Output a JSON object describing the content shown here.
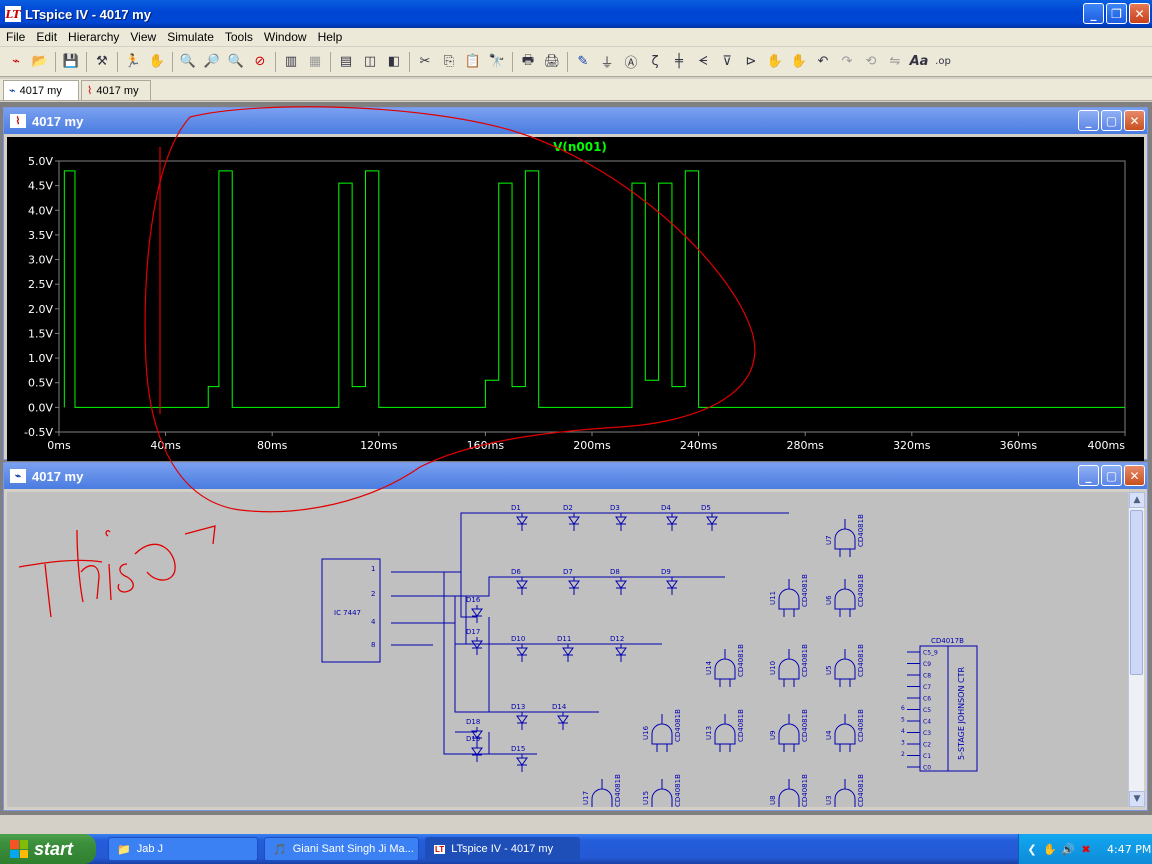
{
  "window": {
    "title": "LTspice IV - 4017 my",
    "app_icon": "LTspice-logo-icon"
  },
  "menu": [
    "File",
    "Edit",
    "Hierarchy",
    "View",
    "Simulate",
    "Tools",
    "Window",
    "Help"
  ],
  "toolbar": {
    "icons": [
      "schematic-icon",
      "open-icon",
      "save-icon",
      "control-panel-icon",
      "run-icon",
      "halt-icon",
      "zoom-in-icon",
      "zoom-pan-icon",
      "zoom-out-icon",
      "zoom-cancel-icon",
      "autorange-icon",
      "fft-icon",
      "tile-horizontal-icon",
      "cascade-icon",
      "tile-vertical-icon",
      "cut-icon",
      "copy-icon",
      "paste-icon",
      "find-icon",
      "print-setup-icon",
      "print-icon",
      "wire-icon",
      "ground-icon",
      "label-icon",
      "resistor-icon",
      "capacitor-icon",
      "inductor-icon",
      "diode-icon",
      "component-icon",
      "move-icon",
      "drag-icon",
      "undo-icon",
      "redo-icon",
      "rotate-icon",
      "mirror-icon",
      "text-icon",
      "spice-directive-icon"
    ]
  },
  "tabs": [
    {
      "label": "4017 my",
      "icon": "schematic-icon"
    },
    {
      "label": "4017 my",
      "icon": "waveform-icon"
    }
  ],
  "plot_window": {
    "title": "4017 my"
  },
  "schematic_window": {
    "title": "4017 my"
  },
  "chart_data": {
    "type": "line",
    "title": "V(n001)",
    "xlabel": "",
    "ylabel": "",
    "xlim": [
      0,
      400
    ],
    "ylim": [
      -0.5,
      5.0
    ],
    "x_ticks": [
      "0ms",
      "40ms",
      "80ms",
      "120ms",
      "160ms",
      "200ms",
      "240ms",
      "280ms",
      "320ms",
      "360ms",
      "400ms"
    ],
    "y_ticks": [
      "5.0V",
      "4.5V",
      "4.0V",
      "3.5V",
      "3.0V",
      "2.5V",
      "2.0V",
      "1.5V",
      "1.0V",
      "0.5V",
      "0.0V",
      "-0.5V"
    ],
    "series_color": "#00ff00",
    "series": [
      {
        "name": "V(n001)",
        "points": [
          [
            2,
            0
          ],
          [
            2,
            4.8
          ],
          [
            6,
            4.8
          ],
          [
            6,
            0
          ],
          [
            56,
            0
          ],
          [
            56,
            0.42
          ],
          [
            60,
            0.42
          ],
          [
            60,
            4.8
          ],
          [
            65,
            4.8
          ],
          [
            65,
            0
          ],
          [
            105,
            0
          ],
          [
            105,
            4.55
          ],
          [
            110,
            4.55
          ],
          [
            110,
            0.42
          ],
          [
            115,
            0.42
          ],
          [
            115,
            4.8
          ],
          [
            120,
            4.8
          ],
          [
            120,
            0
          ],
          [
            160,
            0
          ],
          [
            160,
            0.55
          ],
          [
            165,
            0.55
          ],
          [
            165,
            4.55
          ],
          [
            170,
            4.55
          ],
          [
            170,
            0.42
          ],
          [
            175,
            0.42
          ],
          [
            175,
            4.8
          ],
          [
            180,
            4.8
          ],
          [
            180,
            0
          ],
          [
            215,
            0
          ],
          [
            215,
            4.55
          ],
          [
            220,
            4.55
          ],
          [
            220,
            0.55
          ],
          [
            225,
            0.55
          ],
          [
            225,
            4.55
          ],
          [
            230,
            4.55
          ],
          [
            230,
            0.42
          ],
          [
            235,
            0.42
          ],
          [
            235,
            4.8
          ],
          [
            240,
            4.8
          ],
          [
            240,
            0
          ],
          [
            400,
            0
          ]
        ]
      }
    ],
    "grid": false
  },
  "schematic": {
    "ic7447": {
      "label": "IC 7447",
      "pins": [
        "1",
        "2",
        "4",
        "8"
      ]
    },
    "diodes_row1": [
      "D1",
      "D2",
      "D3",
      "D4",
      "D5"
    ],
    "diodes_row2": [
      "D6",
      "D7",
      "D8",
      "D9"
    ],
    "diodes_row3": [
      "D10",
      "D11",
      "D12"
    ],
    "diodes_row4": [
      "D13",
      "D14"
    ],
    "diodes_misc": [
      "D16",
      "D17",
      "D18",
      "D19",
      "D15"
    ],
    "gates_col1": [
      "U16",
      "U17"
    ],
    "gates_col2": [
      "U14",
      "U13",
      "U15"
    ],
    "gates_col3": [
      "U11",
      "U10",
      "U9",
      "U8"
    ],
    "gates_col4": [
      "U7",
      "U6",
      "U5",
      "U4",
      "U3"
    ],
    "gate_part": "CD4081B",
    "counter": {
      "name": "CD4017B",
      "desc": "5-STAGE JOHNSON CTR",
      "pins": [
        "C5_9",
        "C9",
        "C8",
        "C7",
        "C6",
        "C5",
        "C4",
        "C3",
        "C2",
        "C1",
        "C0"
      ],
      "pin_nums": [
        "6",
        "5",
        "4",
        "3",
        "2"
      ]
    },
    "annotation_text": "This"
  },
  "taskbar": {
    "start": "start",
    "buttons": [
      {
        "label": "Jab J",
        "icon": "folder-icon"
      },
      {
        "label": "Giani Sant Singh Ji Ma...",
        "icon": "media-player-icon"
      },
      {
        "label": "LTspice IV - 4017 my",
        "icon": "LTspice-logo-icon"
      }
    ],
    "clock": "4:47 PM"
  }
}
